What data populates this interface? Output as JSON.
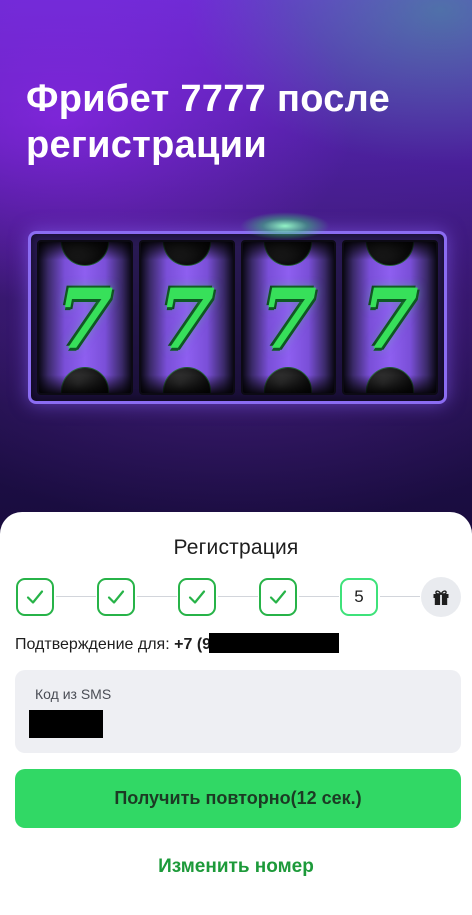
{
  "promo": {
    "title": "Фрибет 7777 после регистрации",
    "reels": [
      "7",
      "7",
      "7",
      "7"
    ]
  },
  "registration": {
    "title": "Регистрация",
    "steps": [
      {
        "state": "done",
        "icon": "check-icon"
      },
      {
        "state": "done",
        "icon": "check-icon"
      },
      {
        "state": "done",
        "icon": "check-icon"
      },
      {
        "state": "done",
        "icon": "check-icon"
      },
      {
        "state": "current",
        "label": "5"
      },
      {
        "state": "final",
        "icon": "gift-icon"
      }
    ],
    "confirm_label": "Подтверждение для:",
    "phone_prefix": "+7 (9",
    "sms_field": {
      "label": "Код из SMS"
    },
    "resend_button": "Получить повторно(12 сек.)",
    "change_number_link": "Изменить номер"
  },
  "colors": {
    "accent_green": "#31d865",
    "link_green": "#1d9a3a",
    "step_border": "#27b348",
    "banner_purple": "#4a1f9a"
  }
}
